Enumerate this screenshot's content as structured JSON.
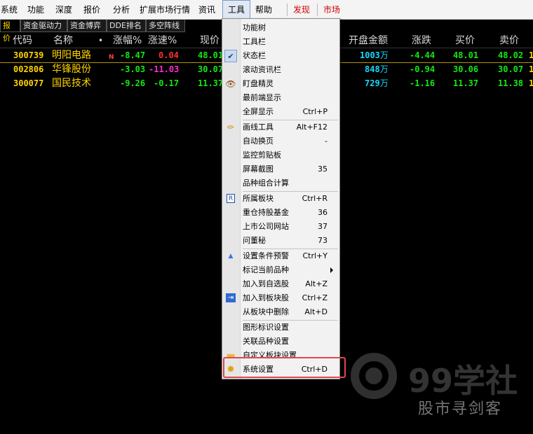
{
  "menubar": {
    "items": [
      "系统",
      "功能",
      "深度",
      "报价",
      "分析",
      "扩展市场行情",
      "资讯",
      "工具",
      "帮助",
      "发现",
      "市场"
    ]
  },
  "subtabs": [
    "报价",
    "资金驱动力",
    "资金博弈",
    "DDE排名",
    "多空阵线"
  ],
  "table": {
    "columns": {
      "code": "代码",
      "name": "名称",
      "dot": "•",
      "change_pct": "涨幅%",
      "speed_pct": "涨速%",
      "price": "现价",
      "open_amount": "开盘金额",
      "change": "涨跌",
      "bid": "买价",
      "ask": "卖价"
    },
    "rows": [
      {
        "code": "300739",
        "name": "明阳电路",
        "flag": "N",
        "change_pct": "-8.47",
        "speed_pct": "0.04",
        "price": "48.01",
        "open_amount": "1003",
        "open_unit": "万",
        "change": "-4.44",
        "bid": "48.01",
        "ask": "48.02",
        "extra": "1"
      },
      {
        "code": "002806",
        "name": "华锋股份",
        "flag": "",
        "change_pct": "-3.03",
        "speed_pct": "-11.03",
        "price": "30.07",
        "open_amount": "848",
        "open_unit": "万",
        "change": "-0.94",
        "bid": "30.06",
        "ask": "30.07",
        "extra": "1"
      },
      {
        "code": "300077",
        "name": "国民技术",
        "flag": "",
        "change_pct": "-9.26",
        "speed_pct": "-0.17",
        "price": "11.37",
        "open_amount": "729",
        "open_unit": "万",
        "change": "-1.16",
        "bid": "11.37",
        "ask": "11.38",
        "extra": "1"
      }
    ]
  },
  "dropdown": {
    "items": [
      {
        "label": "功能树",
        "shortcut": "",
        "icon": ""
      },
      {
        "label": "工具栏",
        "shortcut": "",
        "icon": ""
      },
      {
        "label": "状态栏",
        "shortcut": "",
        "icon": "check-icon",
        "glyph": "✔",
        "checked": true
      },
      {
        "label": "滚动资讯栏",
        "shortcut": "",
        "icon": ""
      },
      {
        "label": "盯盘精灵",
        "shortcut": "",
        "icon": "eye-icon",
        "glyph": "👁"
      },
      {
        "label": "最前端显示",
        "shortcut": "",
        "icon": ""
      },
      {
        "label": "全屏显示",
        "shortcut": "Ctrl+P",
        "icon": ""
      },
      {
        "label": "画线工具",
        "shortcut": "Alt+F12",
        "icon": "pencil-icon",
        "glyph": "✏"
      },
      {
        "label": "自动换页",
        "shortcut": "-",
        "icon": ""
      },
      {
        "label": "监控剪贴板",
        "shortcut": "",
        "icon": ""
      },
      {
        "label": "屏幕截图",
        "shortcut": "35",
        "icon": ""
      },
      {
        "label": "品种组合计算",
        "shortcut": "",
        "icon": ""
      },
      {
        "label": "所属板块",
        "shortcut": "Ctrl+R",
        "icon": "r-box-icon",
        "glyph": "R"
      },
      {
        "label": "重仓持股基金",
        "shortcut": "36",
        "icon": ""
      },
      {
        "label": "上市公司网站",
        "shortcut": "37",
        "icon": ""
      },
      {
        "label": "问董秘",
        "shortcut": "73",
        "icon": ""
      },
      {
        "label": "设置条件预警",
        "shortcut": "Ctrl+Y",
        "icon": "alert-up-icon",
        "glyph": "▲"
      },
      {
        "label": "标记当前品种",
        "shortcut": "",
        "icon": "",
        "submenu": true
      },
      {
        "label": "加入到自选股",
        "shortcut": "Alt+Z",
        "icon": ""
      },
      {
        "label": "加入到板块股",
        "shortcut": "Ctrl+Z",
        "icon": "add-to-block-icon",
        "glyph": "⇥"
      },
      {
        "label": "从板块中删除",
        "shortcut": "Alt+D",
        "icon": ""
      },
      {
        "label": "图形标识设置",
        "shortcut": "",
        "icon": ""
      },
      {
        "label": "关联品种设置",
        "shortcut": "",
        "icon": ""
      },
      {
        "label": "自定义板块设置",
        "shortcut": "",
        "icon": "folder-icon",
        "glyph": "▬"
      },
      {
        "label": "系统设置",
        "shortcut": "Ctrl+D",
        "icon": "gear-icon",
        "glyph": "✹"
      }
    ]
  },
  "watermark": {
    "brand": "99学社",
    "caption": "股市寻剑客"
  },
  "colors": {
    "up": "#ff3131",
    "down": "#13e813",
    "code": "#ffd400",
    "amount": "#18d8ff",
    "highlight": "#e0474b"
  }
}
